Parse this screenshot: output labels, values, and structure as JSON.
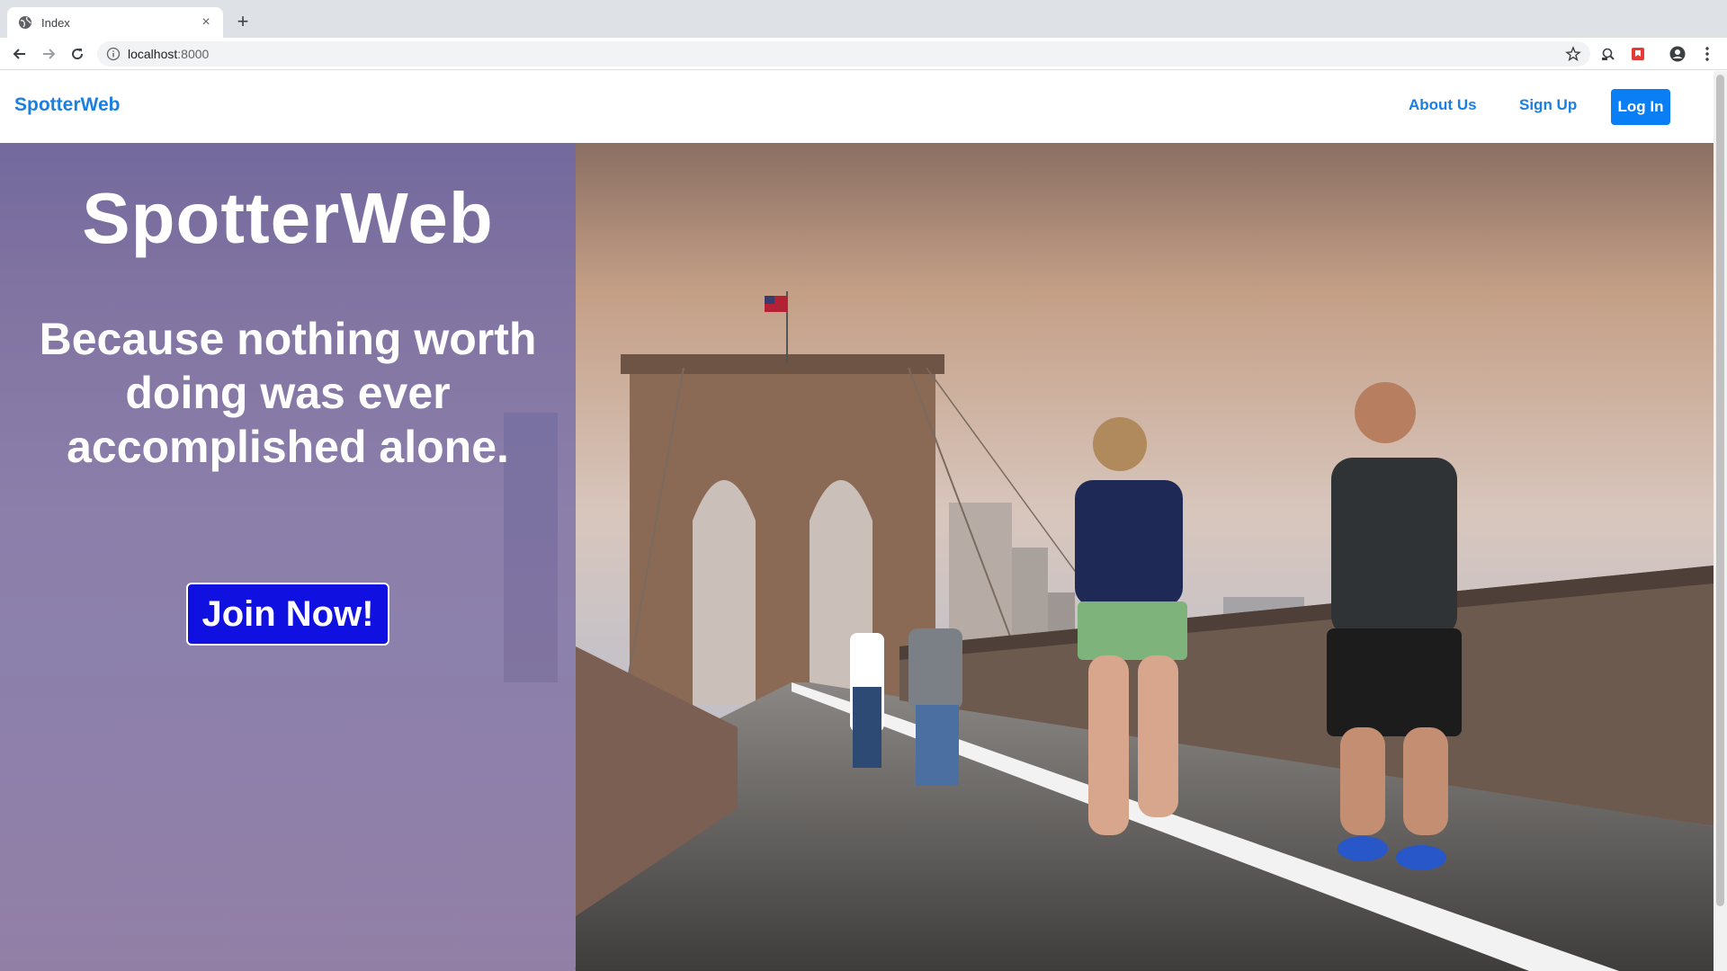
{
  "browser": {
    "tab_title": "Index",
    "tab_close": "×",
    "new_tab": "+",
    "url_host": "localhost",
    "url_port": ":8000"
  },
  "nav": {
    "brand": "SpotterWeb",
    "links": [
      "About Us",
      "Sign Up"
    ],
    "login": "Log In"
  },
  "hero": {
    "title": "SpotterWeb",
    "tagline": "Because nothing worth doing was ever accomplished alone.",
    "cta": "Join Now!"
  },
  "colors": {
    "brand_blue": "#1a7fe0",
    "login_bg": "#0a7ff5",
    "cta_bg": "#1010e0",
    "overlay": "#6e68aa"
  }
}
